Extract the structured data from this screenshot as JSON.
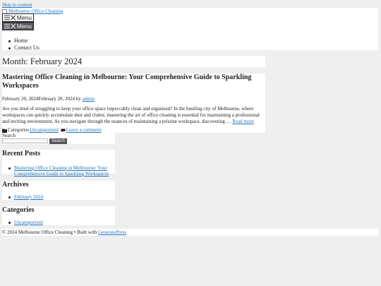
{
  "skip_link": "Skip to content",
  "header": {
    "logo_text": "Melbourne Office Cleaning",
    "menu_label": "Menu",
    "nav": [
      "Home",
      "Contact Us"
    ]
  },
  "archive_title": "Month: February 2024",
  "post": {
    "title": "Mastering Office Cleaning in Melbourne: Your Comprehensive Guide to Sparkling Workspaces",
    "date_published": "February 20, 2024",
    "date_updated": "February 20, 2024",
    "by": "by",
    "author": "admin",
    "excerpt": "Are you tired of struggling to keep your office space impeccably clean and organised? In the bustling city of Melbourne, where workspaces can quickly accumulate dust and clutter, mastering the art of office cleaning is essential for maintaining a professional and inviting environment. As you navigate through the nuances of maintaining a pristine workspace, discovering …",
    "read_more": "Read more",
    "categories_label": "Categories",
    "category": "Uncategorized",
    "comment_link": "Leave a comment"
  },
  "sidebar": {
    "search_label": "Search",
    "search_button": "Search",
    "recent_posts_title": "Recent Posts",
    "recent_posts": [
      "Mastering Office Cleaning in Melbourne: Your Comprehensive Guide to Sparkling Workspaces"
    ],
    "archives_title": "Archives",
    "archives": [
      "February 2024"
    ],
    "categories_title": "Categories",
    "categories": [
      "Uncategorized"
    ]
  },
  "footer": {
    "copyright": "© 2024 Melbourne Office Cleaning • Built with ",
    "builder": "GeneratePress"
  }
}
